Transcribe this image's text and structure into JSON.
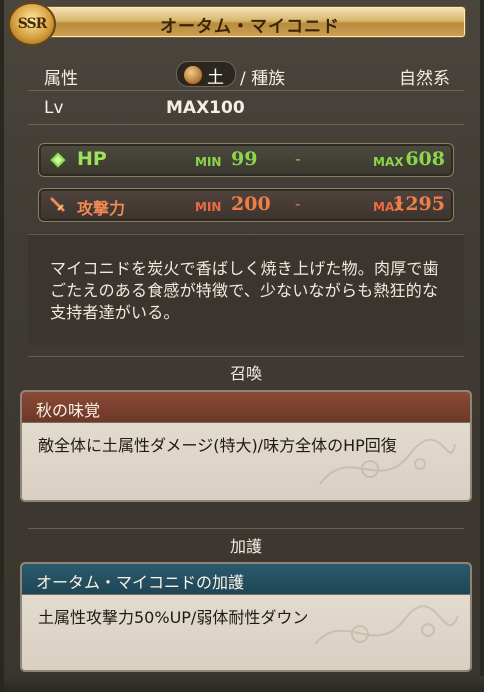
{
  "header": {
    "rarity": "SSR",
    "title": "オータム・マイコニド"
  },
  "info": {
    "attribute_label": "属性",
    "attribute_value": "土",
    "race_label": "/ 種族",
    "race_value": "自然系",
    "level_label": "Lv",
    "level_value": "MAX100"
  },
  "stats": {
    "hp": {
      "label": "HP",
      "min_label": "MIN",
      "min": "99",
      "sep": "-",
      "max_label": "MAX",
      "max": "608"
    },
    "atk": {
      "label": "攻撃力",
      "min_label": "MIN",
      "min": "200",
      "sep": "-",
      "max_label": "MAX",
      "max": "1295"
    }
  },
  "description": "マイコニドを炭火で香ばしく焼き上げた物。肉厚で歯ごたえのある食感が特徴で、少ないながらも熱狂的な支持者達がいる。",
  "summon": {
    "section_title": "召喚",
    "name": "秋の味覚",
    "effect": "敵全体に土属性ダメージ(特大)/味方全体のHP回復"
  },
  "aura": {
    "section_title": "加護",
    "name": "オータム・マイコニドの加護",
    "effect": "土属性攻撃力50%UP/弱体耐性ダウン"
  },
  "colors": {
    "hp": "#8bd64b",
    "atk": "#f07e48",
    "summon_header": "#7a3f2f",
    "aura_header": "#245062"
  }
}
